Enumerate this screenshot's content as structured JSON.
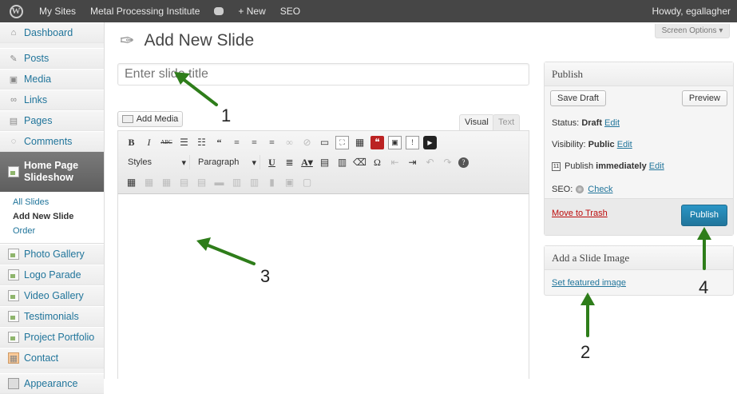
{
  "adminbar": {
    "wp_logo": "W",
    "my_sites": "My Sites",
    "site_name": "Metal Processing Institute",
    "comments_icon": "speech-bubble-icon",
    "new_label": "+ New",
    "seo_label": "SEO",
    "howdy": "Howdy, egallagher"
  },
  "sidebar": {
    "items": [
      {
        "label": "Dashboard",
        "icon": "home-icon"
      },
      {
        "label": "Posts",
        "icon": "pin-icon"
      },
      {
        "label": "Media",
        "icon": "media-icon"
      },
      {
        "label": "Links",
        "icon": "links-icon"
      },
      {
        "label": "Pages",
        "icon": "pages-icon"
      },
      {
        "label": "Comments",
        "icon": "comments-icon"
      }
    ],
    "current": {
      "line1": "Home Page",
      "line2": "Slideshow"
    },
    "submenu": [
      "All Slides",
      "Add New Slide",
      "Order"
    ],
    "items2": [
      {
        "label": "Photo Gallery"
      },
      {
        "label": "Logo Parade"
      },
      {
        "label": "Video Gallery"
      },
      {
        "label": "Testimonials"
      },
      {
        "label": "Project Portfolio"
      },
      {
        "label": "Contact"
      },
      {
        "label": "Appearance"
      }
    ]
  },
  "page": {
    "title": "Add New Slide",
    "screen_options": "Screen Options ▾",
    "title_placeholder": "Enter slide title"
  },
  "editor": {
    "add_media": "Add Media",
    "tab_visual": "Visual",
    "tab_text": "Text",
    "styles_select": "Styles",
    "format_select": "Paragraph"
  },
  "publish": {
    "title": "Publish",
    "save_draft": "Save Draft",
    "preview": "Preview",
    "status_label": "Status:",
    "status_value": "Draft",
    "visibility_label": "Visibility:",
    "visibility_value": "Public",
    "schedule_label": "Publish",
    "schedule_value": "immediately",
    "edit": "Edit",
    "seo_label": "SEO:",
    "seo_check": "Check",
    "move_to_trash": "Move to Trash",
    "publish_button": "Publish"
  },
  "slide_image": {
    "title": "Add a Slide Image",
    "set_featured": "Set featured image"
  },
  "annotations": {
    "n1": "1",
    "n2": "2",
    "n3": "3",
    "n4": "4",
    "arrow_color": "#2e7d1a"
  }
}
